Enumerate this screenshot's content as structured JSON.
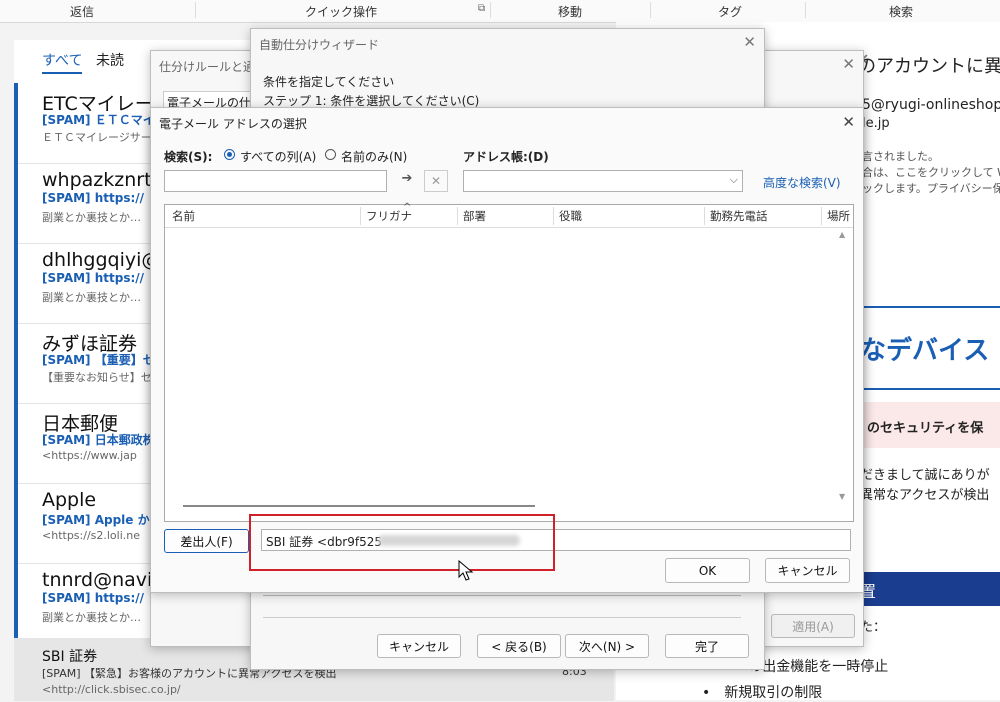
{
  "ribbon": {
    "groups": [
      "返信",
      "クイック操作",
      "移動",
      "タグ",
      "検索"
    ]
  },
  "maillist": {
    "tabs": [
      "すべて",
      "未読"
    ],
    "items": [
      {
        "sender": "ETCマイレージ",
        "subject": "[SPAM] ＥＴＣマイ",
        "preview": "ＥＴＣマイレージサービ"
      },
      {
        "sender": "whpazkznrt",
        "subject": "[SPAM] https://",
        "preview": "副業とか裏技とか…　そ"
      },
      {
        "sender": "dhlhggqiyi@",
        "subject": "[SPAM] https://",
        "preview": "副業とか裏技とか…　そ"
      },
      {
        "sender": "みずほ証券",
        "subject": "[SPAM] 【重要】セキ",
        "preview": "【重要なお知らせ】セキ"
      },
      {
        "sender": "日本郵便",
        "subject": "[SPAM] 日本郵政株",
        "preview": "<https://www.jap"
      },
      {
        "sender": "Apple",
        "subject": "[SPAM] Apple か",
        "preview": "<https://s2.loli.ne"
      },
      {
        "sender": "tnnrd@navi",
        "subject": "[SPAM] https://",
        "preview": "副業とか裏技とか…　そ"
      }
    ],
    "selected": {
      "sender": "SBI 証券",
      "subject": "[SPAM] 【緊急】お客様のアカウントに異常アクセスを検出",
      "time": "8:03",
      "preview": "<http://click.sbisec.co.jp/"
    }
  },
  "reading": {
    "title": "のアカウントに異常ア",
    "from": "5@ryugi-onlineshop",
    "from2": "le.jp",
    "note1": "言されました。",
    "note2": "合は、ここをクリックして Web フ",
    "note3": "ックします。プライバシー保護を",
    "banner": "なデバイス",
    "alert": "のセキュリティを保",
    "body1": "だきまして誠にありが",
    "body2": "異常なアクセスが検出",
    "section": "置",
    "section_sub": "た：",
    "bullets": [
      "の出金機能を一時停止",
      "新規取引の制限"
    ],
    "accent": "#1a5fb4"
  },
  "rules_dialog": {
    "title": "仕分けルールと通知",
    "email_label": "電子メールの仕分",
    "apply": "適用(A)"
  },
  "wizard": {
    "title": "自動仕分けウィザード",
    "prompt": "条件を指定してください",
    "step": "ステップ 1: 条件を選択してください(C)",
    "cancel": "キャンセル",
    "back": "< 戻る(B)",
    "next": "次へ(N) >",
    "finish": "完了"
  },
  "address_dialog": {
    "title": "電子メール アドレスの選択",
    "search_label": "検索(S):",
    "radio_all": "すべての列(A)",
    "radio_name": "名前のみ(N)",
    "addressbook_label": "アドレス帳:(D)",
    "search_value": "",
    "addressbook_value": "",
    "advanced": "高度な検索(V)",
    "columns": [
      "名前",
      "フリガナ",
      "部署",
      "役職",
      "勤務先電話",
      "場所"
    ],
    "from_button": "差出人(F)",
    "from_value": "SBI 証券 <dbr9f525",
    "ok": "OK",
    "cancel": "キャンセル",
    "highlight_color": "#d0202a"
  }
}
